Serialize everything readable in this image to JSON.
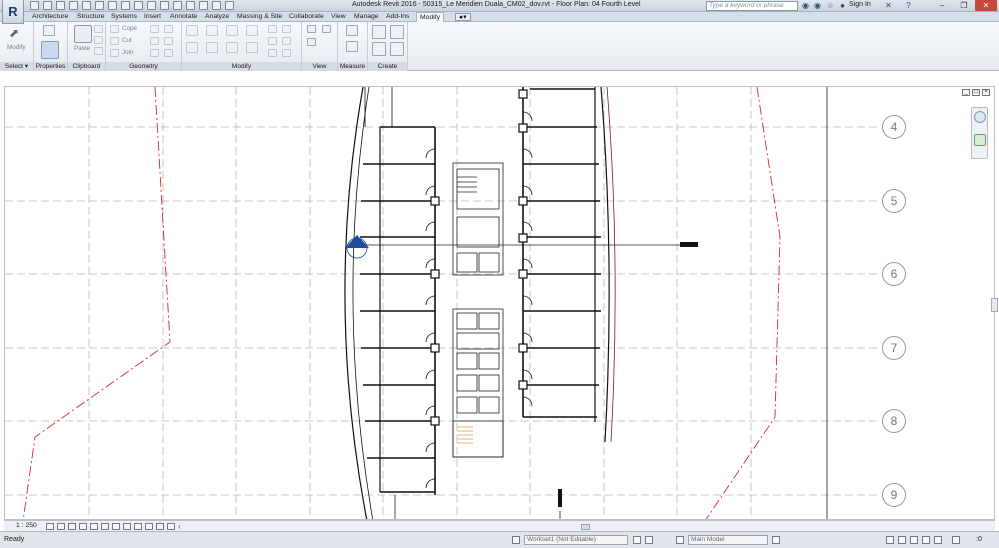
{
  "app": {
    "title": "Autodesk Revit 2016  -  50315_Le Meridien Duala_CM02_dov.rvt - Floor Plan: 04 Fourth Level",
    "logo": "R",
    "search_placeholder": "Type a keyword or phrase",
    "sign_in": "Sign In"
  },
  "ribbon_tabs": [
    "Architecture",
    "Structure",
    "Systems",
    "Insert",
    "Annotate",
    "Analyze",
    "Massing & Site",
    "Collaborate",
    "View",
    "Manage",
    "Add-Ins",
    "Modify"
  ],
  "active_tab": "Modify",
  "panels": {
    "select": "Select",
    "properties": "Properties",
    "clipboard": "Clipboard",
    "geometry": "Geometry",
    "modify": "Modify",
    "view": "View",
    "measure": "Measure",
    "create": "Create"
  },
  "ribbon_labels": {
    "modify_tool": "Modify",
    "paste": "Paste",
    "cope": "Cope",
    "cut": "Cut",
    "join": "Join"
  },
  "grid_labels": [
    "4",
    "5",
    "6",
    "7",
    "8",
    "9"
  ],
  "view_bar": {
    "scale": "1 : 250"
  },
  "status": {
    "ready": "Ready",
    "workset": "Workset1 (Not Editable)",
    "design_option": "Main Model",
    "filter_count": ":0"
  },
  "colors": {
    "ribbon_bg": "#e6ebf0",
    "title_bg": "#c9d3de",
    "grid_line": "#b0b0b0",
    "red_boundary": "#cc2b2b",
    "section_marker": "#1f4e9a",
    "stair_highlight": "#e6a04a"
  }
}
